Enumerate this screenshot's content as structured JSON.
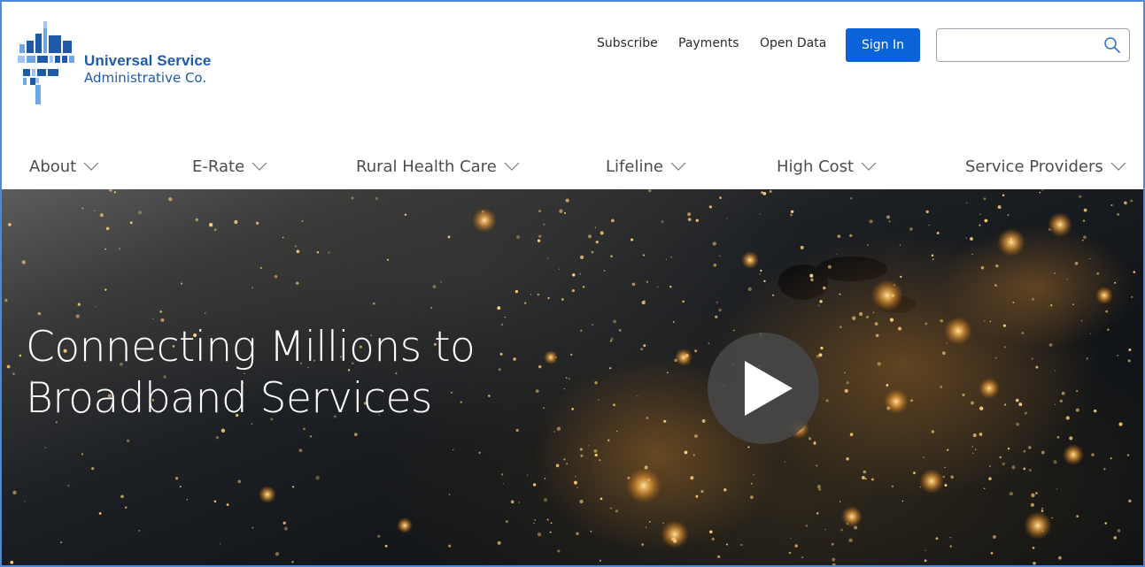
{
  "brand": {
    "line1": "Universal Service",
    "line2": "Administrative Co.",
    "color": "#1f5aa8",
    "accent": "#4a8fe0"
  },
  "utility_nav": {
    "subscribe": "Subscribe",
    "payments": "Payments",
    "open_data": "Open Data",
    "sign_in": "Sign In",
    "search_placeholder": "",
    "search_icon": "search-icon"
  },
  "main_nav": {
    "items": [
      {
        "label": "About",
        "icon": "chevron-down-icon"
      },
      {
        "label": "E-Rate",
        "icon": "chevron-down-icon"
      },
      {
        "label": "Rural Health Care",
        "icon": "chevron-down-icon"
      },
      {
        "label": "Lifeline",
        "icon": "chevron-down-icon"
      },
      {
        "label": "High Cost",
        "icon": "chevron-down-icon"
      },
      {
        "label": "Service Providers",
        "icon": "chevron-down-icon"
      }
    ]
  },
  "hero": {
    "title_line1": "Connecting Millions to",
    "title_line2": "Broadband Services",
    "play_icon": "play-icon"
  },
  "colors": {
    "sign_in_bg": "#0a63d8",
    "frame_border": "#4a89dc"
  }
}
